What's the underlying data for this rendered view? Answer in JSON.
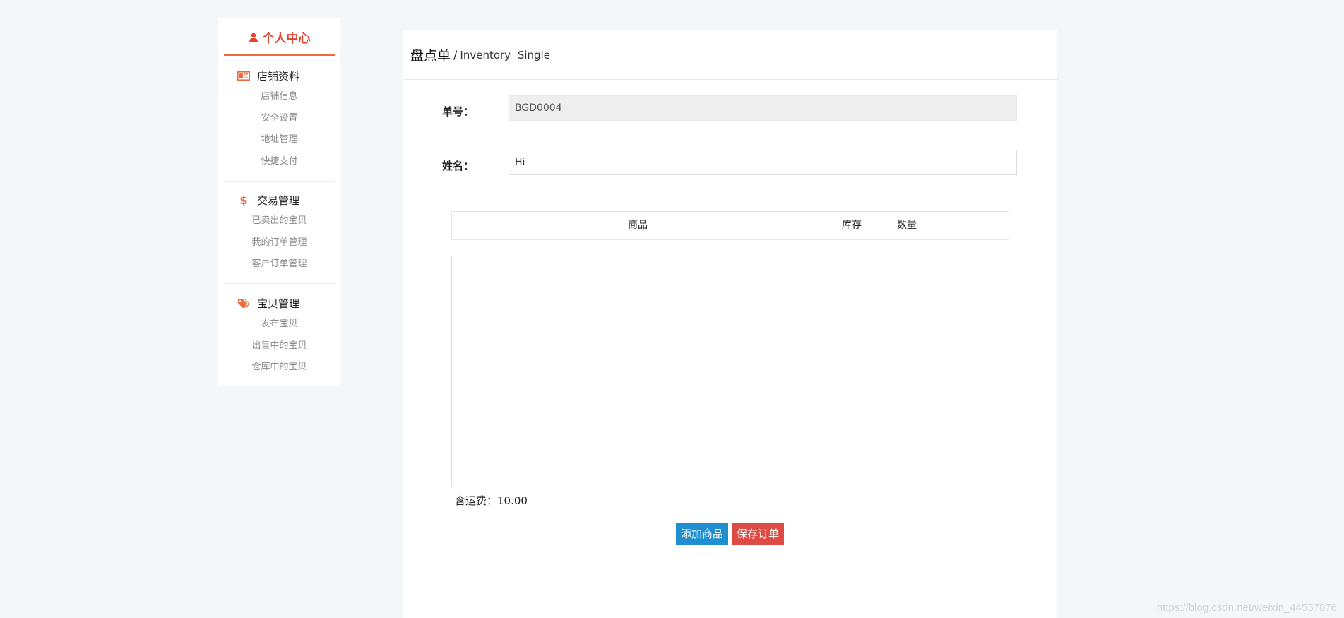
{
  "sidebar": {
    "title": "个人中心",
    "groups": [
      {
        "title": "店铺资料",
        "icon": "newspaper-icon",
        "items": [
          "店铺信息",
          "安全设置",
          "地址管理",
          "快捷支付"
        ]
      },
      {
        "title": "交易管理",
        "icon": "dollar-icon",
        "items": [
          "已卖出的宝贝",
          "我的订单管理",
          "客户订单管理"
        ]
      },
      {
        "title": "宝贝管理",
        "icon": "tags-icon",
        "items": [
          "发布宝贝",
          "出售中的宝贝",
          "仓库中的宝贝"
        ]
      }
    ]
  },
  "colors": {
    "accent": "#f06a3c",
    "title_red": "#e8402e",
    "primary_button": "#1f8fd0",
    "danger_button": "#dd4b44",
    "page_background": "#f4f7fa"
  },
  "main": {
    "title_cn": "盘点单",
    "title_sep": "/",
    "title_en": "Inventory Single",
    "fields": {
      "order_no_label": "单号：",
      "order_no_value": "BGD0004",
      "name_label": "姓名：",
      "name_value": "Hi"
    },
    "table": {
      "columns": [
        "商品",
        "库存",
        "数量"
      ],
      "rows": []
    },
    "shipping_text": "含运费：10.00",
    "buttons": {
      "add_label": "添加商品",
      "save_label": "保存订单"
    }
  },
  "watermark": "https://blog.csdn.net/weixin_44537876"
}
